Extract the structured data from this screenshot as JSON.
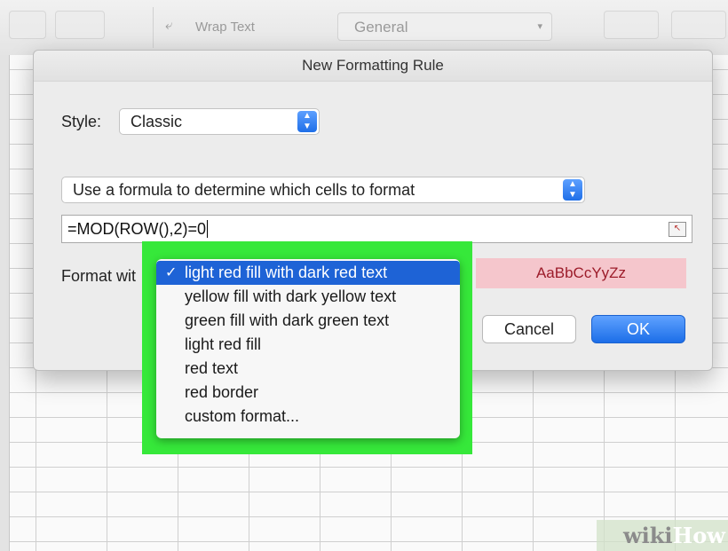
{
  "toolbar": {
    "wrap_text_label": "Wrap Text",
    "number_format": "General"
  },
  "dialog": {
    "title": "New Formatting Rule",
    "style_label": "Style:",
    "style_value": "Classic",
    "rule_type": "Use a formula to determine which cells to format",
    "formula": "=MOD(ROW(),2)=0",
    "format_with_label": "Format wit",
    "preview_text": "AaBbCcYyZz",
    "cancel_label": "Cancel",
    "ok_label": "OK"
  },
  "format_menu": {
    "selected_index": 0,
    "items": [
      "light red fill with dark red text",
      "yellow fill with dark yellow text",
      "green fill with dark green text",
      "light red fill",
      "red text",
      "red border",
      "custom format..."
    ]
  },
  "colors": {
    "highlight_box": "#36e83a",
    "selection": "#1e63d6",
    "preview_fill": "#f5c6cc",
    "preview_text": "#9c1c2a",
    "ok_button": "#1c6ee8"
  },
  "watermark": {
    "part1": "wiki",
    "part2": "How"
  }
}
